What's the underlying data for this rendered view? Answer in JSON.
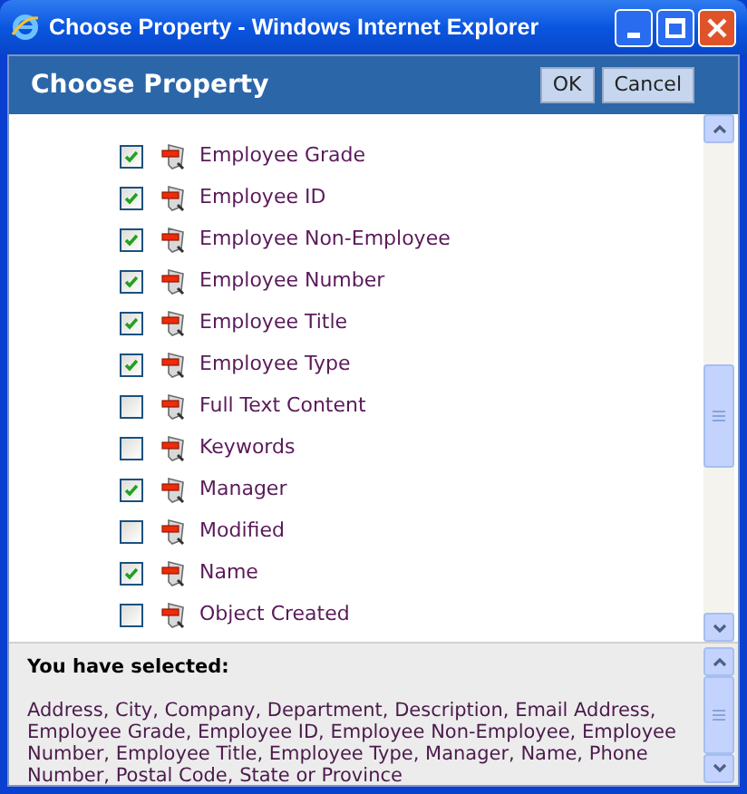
{
  "window": {
    "title": "Choose Property - Windows Internet Explorer"
  },
  "header": {
    "title": "Choose Property",
    "buttons": [
      {
        "label": "OK"
      },
      {
        "label": "Cancel"
      }
    ]
  },
  "properties": [
    {
      "label": "Employee Grade",
      "checked": true
    },
    {
      "label": "Employee ID",
      "checked": true
    },
    {
      "label": "Employee Non-Employee",
      "checked": true
    },
    {
      "label": "Employee Number",
      "checked": true
    },
    {
      "label": "Employee Title",
      "checked": true
    },
    {
      "label": "Employee Type",
      "checked": true
    },
    {
      "label": "Full Text Content",
      "checked": false
    },
    {
      "label": "Keywords",
      "checked": false
    },
    {
      "label": "Manager",
      "checked": true
    },
    {
      "label": "Modified",
      "checked": false
    },
    {
      "label": "Name",
      "checked": true
    },
    {
      "label": "Object Created",
      "checked": false
    }
  ],
  "selection": {
    "heading": "You have selected:",
    "text": "Address, City, Company, Department, Description, Email Address, Employee Grade, Employee ID, Employee Non-Employee, Employee Number, Employee Title, Employee Type, Manager, Name, Phone Number, Postal Code, State or Province"
  }
}
